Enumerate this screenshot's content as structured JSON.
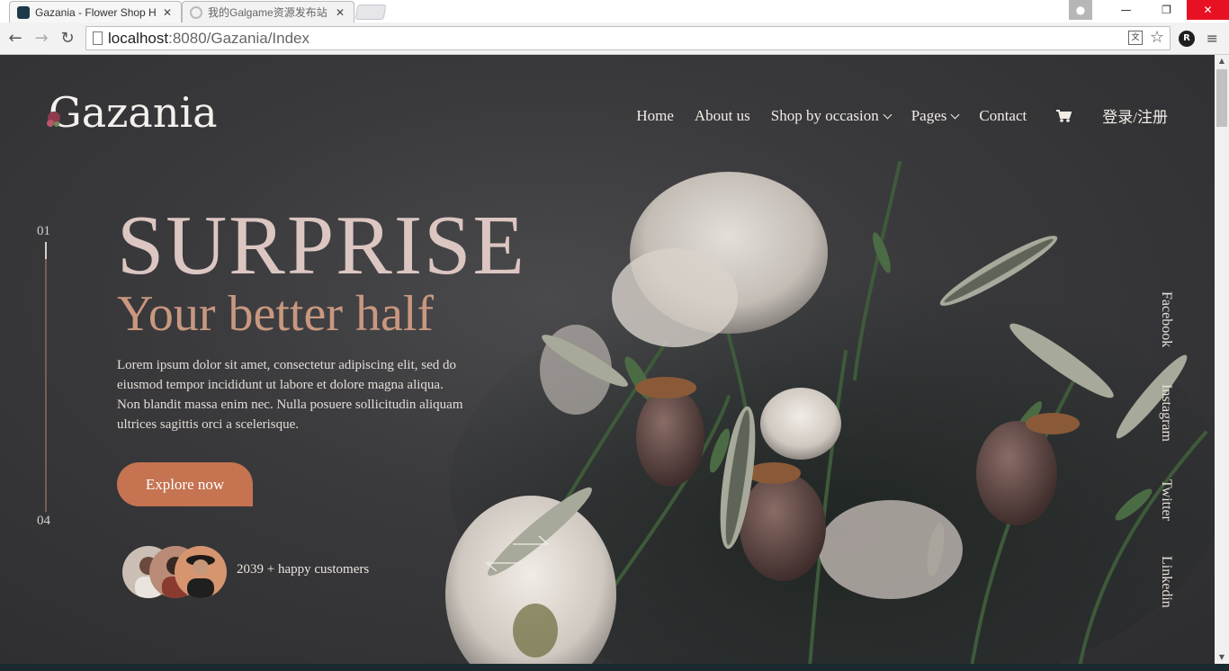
{
  "browser": {
    "tabs": [
      {
        "title": "Gazania - Flower Shop H",
        "active": true
      },
      {
        "title": "我的Galgame资源发布站",
        "active": false
      }
    ],
    "url_host": "localhost",
    "url_path": ":8080/Gazania/Index",
    "translate_icon_label": "文"
  },
  "header": {
    "logo": "Gazania",
    "nav": [
      {
        "label": "Home",
        "dropdown": false
      },
      {
        "label": "About us",
        "dropdown": false
      },
      {
        "label": "Shop by occasion",
        "dropdown": true
      },
      {
        "label": "Pages",
        "dropdown": true
      },
      {
        "label": "Contact",
        "dropdown": false
      }
    ],
    "login": "登录/注册"
  },
  "slider": {
    "current": "01",
    "total": "04",
    "progress": 0.25
  },
  "hero": {
    "title": "SURPRISE",
    "subtitle": "Your better half",
    "description": "Lorem ipsum dolor sit amet, consectetur adipiscing elit, sed do eiusmod tempor incididunt ut labore et dolore magna aliqua. Non blandit massa enim nec. Nulla posuere sollicitudin aliquam ultrices sagittis orci a scelerisque.",
    "cta": "Explore now",
    "customers": "2039 + happy customers"
  },
  "social": [
    "Facebook",
    "Instagram",
    "Twitter",
    "Linkedin"
  ],
  "colors": {
    "accent": "#c57351",
    "title": "#dcc6c2",
    "subtitle": "#c9987f",
    "background": "#3a3a3d"
  }
}
